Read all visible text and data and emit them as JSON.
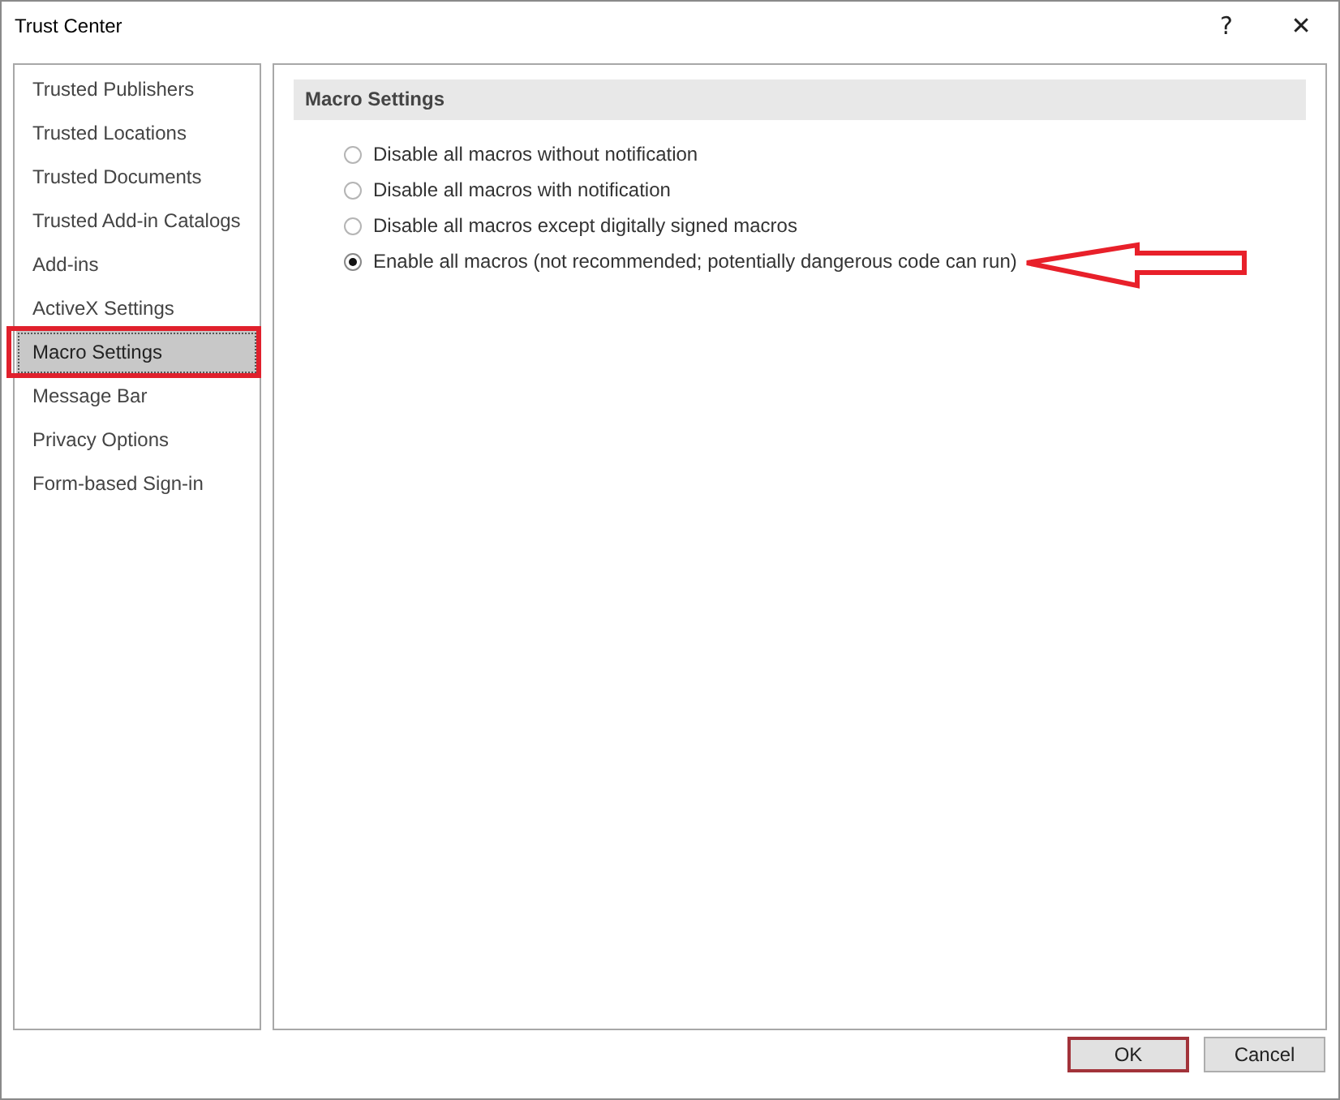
{
  "window": {
    "title": "Trust Center",
    "help": "?",
    "close": "✕"
  },
  "sidebar": {
    "items": [
      {
        "label": "Trusted Publishers",
        "selected": false
      },
      {
        "label": "Trusted Locations",
        "selected": false
      },
      {
        "label": "Trusted Documents",
        "selected": false
      },
      {
        "label": "Trusted Add-in Catalogs",
        "selected": false
      },
      {
        "label": "Add-ins",
        "selected": false
      },
      {
        "label": "ActiveX Settings",
        "selected": false
      },
      {
        "label": "Macro Settings",
        "selected": true
      },
      {
        "label": "Message Bar",
        "selected": false
      },
      {
        "label": "Privacy Options",
        "selected": false
      },
      {
        "label": "Form-based Sign-in",
        "selected": false
      }
    ]
  },
  "section": {
    "title": "Macro Settings",
    "options": [
      {
        "label": "Disable all macros without notification",
        "selected": false
      },
      {
        "label": "Disable all macros with notification",
        "selected": false
      },
      {
        "label": "Disable all macros except digitally signed macros",
        "selected": false
      },
      {
        "label": "Enable all macros (not recommended; potentially dangerous code can run)",
        "selected": true
      }
    ]
  },
  "buttons": [
    {
      "label": "OK",
      "kind": "default"
    },
    {
      "label": "Cancel",
      "kind": "normal"
    }
  ]
}
